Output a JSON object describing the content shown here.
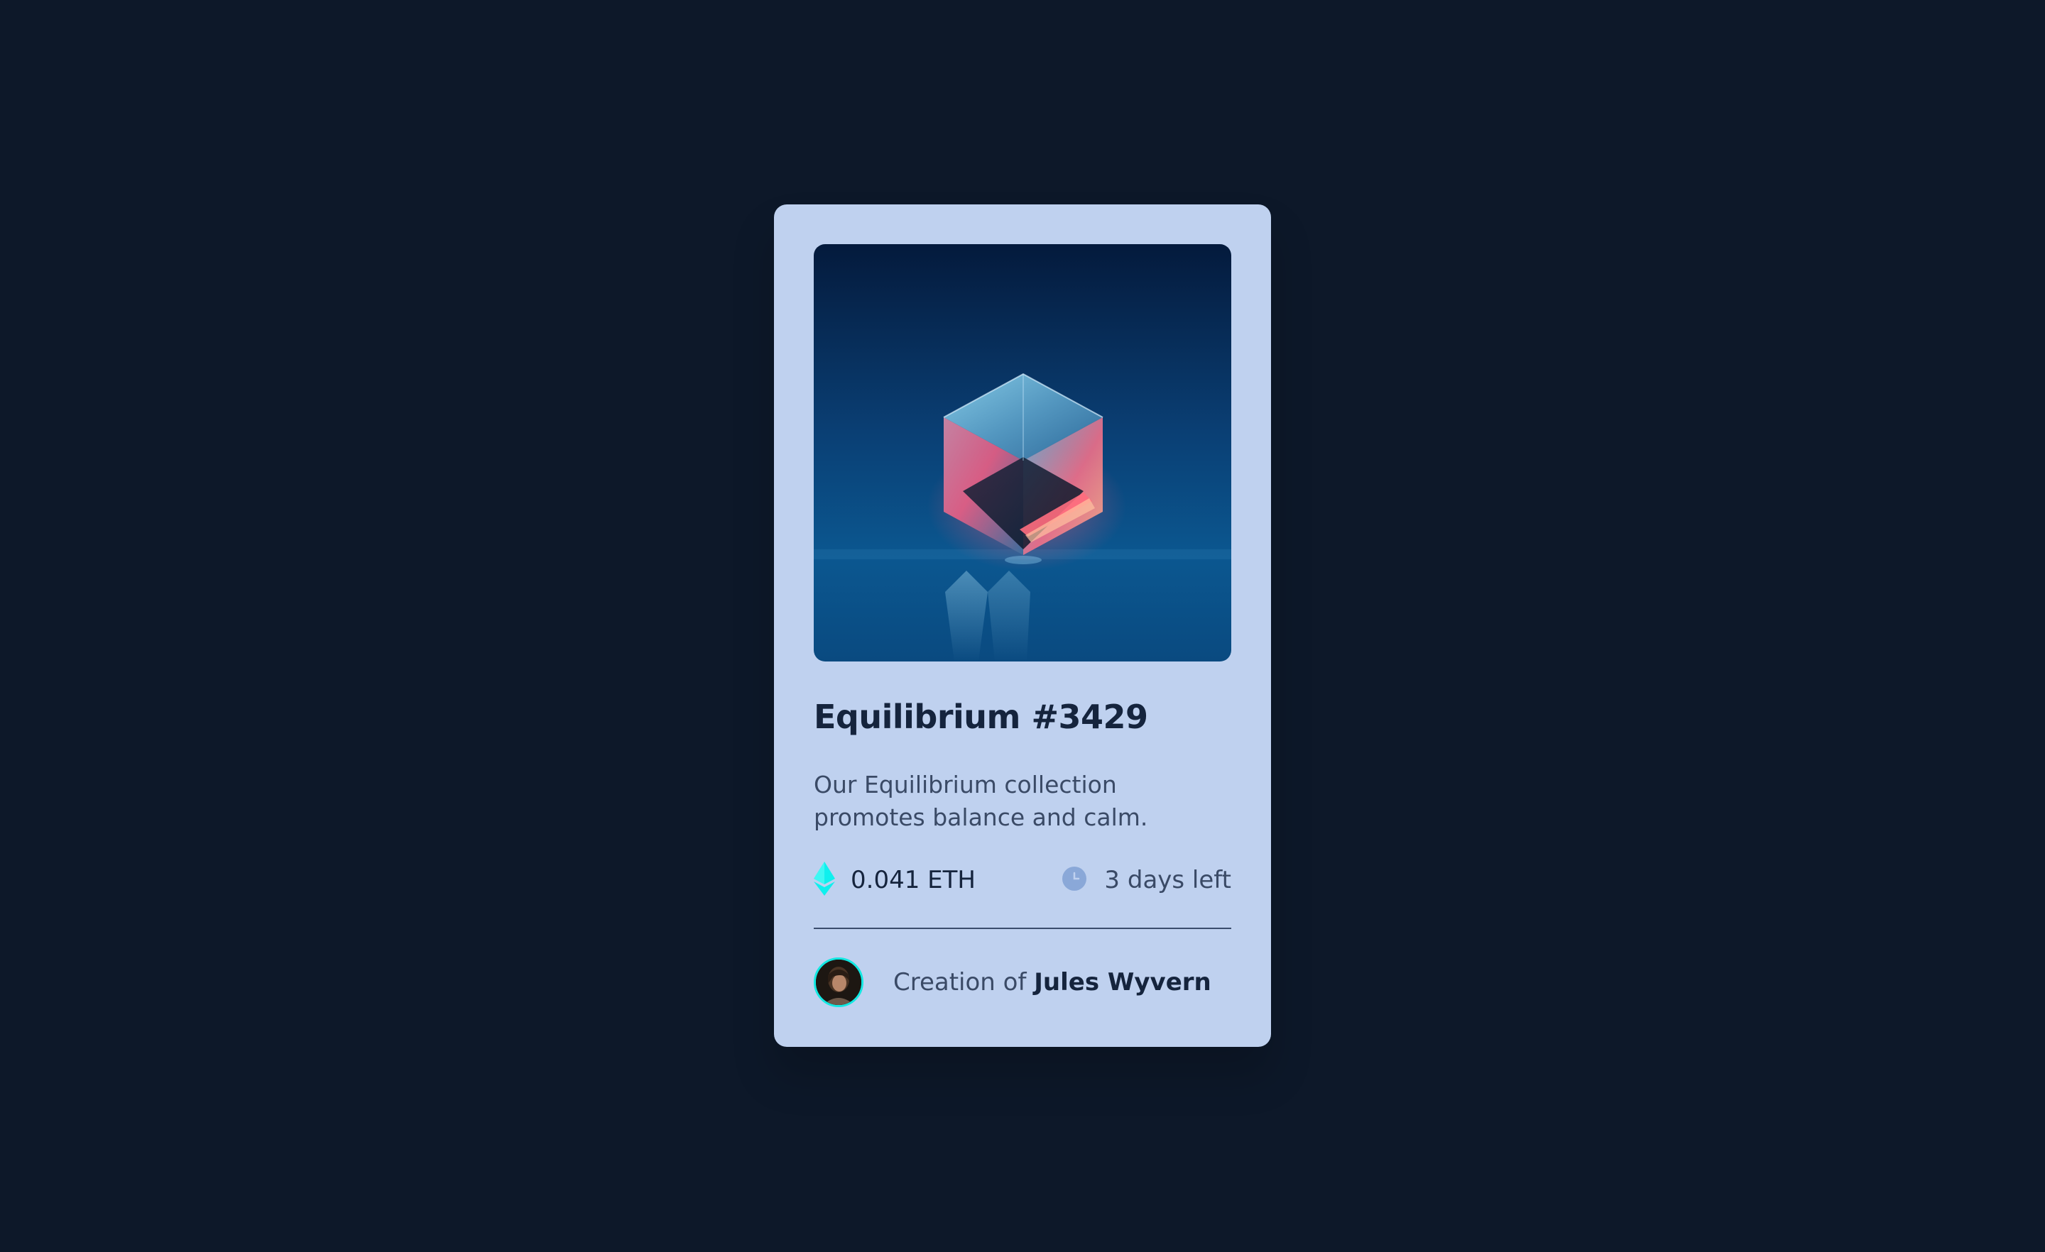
{
  "card": {
    "image_alt": "Equilibrium cube",
    "title": "Equilibrium #3429",
    "description": "Our Equilibrium collection promotes balance and calm.",
    "price": "0.041 ETH",
    "time_left": "3 days left",
    "creator_prefix": "Creation of ",
    "creator_name": "Jules Wyvern"
  },
  "icons": {
    "price": "ethereum-icon",
    "time": "clock-icon"
  },
  "colors": {
    "page_background": "#0d1829",
    "card_background": "#bfd1ef",
    "accent_cyan": "#12e8e2",
    "heading": "#15243d",
    "body_text": "#3a4a66"
  }
}
